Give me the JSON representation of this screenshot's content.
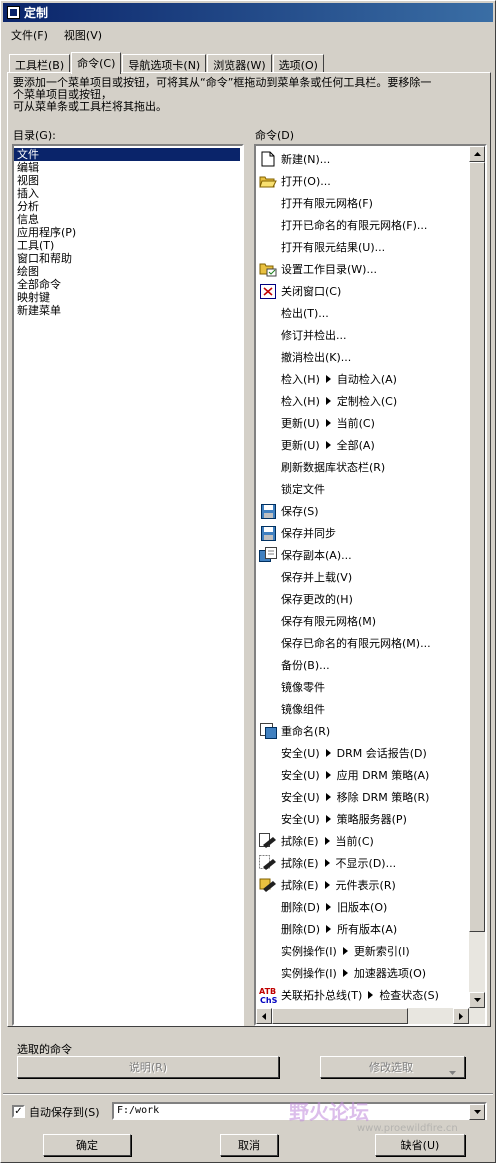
{
  "window": {
    "title": "定制"
  },
  "menubar": [
    {
      "label": "文件(F)"
    },
    {
      "label": "视图(V)"
    }
  ],
  "tabs": [
    {
      "label": "工具栏(B)",
      "active": false
    },
    {
      "label": "命令(C)",
      "active": true
    },
    {
      "label": "导航选项卡(N)",
      "active": false
    },
    {
      "label": "浏览器(W)",
      "active": false
    },
    {
      "label": "选项(O)",
      "active": false
    }
  ],
  "description": "要添加一个菜单项目或按钮，可将其从“命令”框拖动到菜单条或任何工具栏。要移除一\n个菜单项目或按钮，\n可从菜单条或工具栏将其拖出。",
  "categories": {
    "label": "目录(G):",
    "items": [
      "文件",
      "编辑",
      "视图",
      "插入",
      "分析",
      "信息",
      "应用程序(P)",
      "工具(T)",
      "窗口和帮助",
      "绘图",
      "全部命令",
      "映射键",
      "新建菜单"
    ],
    "selected_index": 0
  },
  "commands": {
    "label": "命令(D)",
    "items": [
      {
        "icon": "new-document-icon",
        "text": "新建(N)..."
      },
      {
        "icon": "open-folder-icon",
        "text": "打开(O)..."
      },
      {
        "icon": "",
        "text": "打开有限元网格(F)"
      },
      {
        "icon": "",
        "text": "打开已命名的有限元网格(F)..."
      },
      {
        "icon": "",
        "text": "打开有限元结果(U)..."
      },
      {
        "icon": "working-directory-icon",
        "text": "设置工作目录(W)..."
      },
      {
        "icon": "close-window-icon",
        "text": "关闭窗口(C)"
      },
      {
        "icon": "",
        "text": "检出(T)..."
      },
      {
        "icon": "",
        "text": "修订并检出..."
      },
      {
        "icon": "",
        "text": "撤消检出(K)..."
      },
      {
        "icon": "",
        "text": "检入(H)",
        "sub": "自动检入(A)"
      },
      {
        "icon": "",
        "text": "检入(H)",
        "sub": "定制检入(C)"
      },
      {
        "icon": "",
        "text": "更新(U)",
        "sub": "当前(C)"
      },
      {
        "icon": "",
        "text": "更新(U)",
        "sub": "全部(A)"
      },
      {
        "icon": "",
        "text": "刷新数据库状态栏(R)"
      },
      {
        "icon": "",
        "text": "锁定文件"
      },
      {
        "icon": "save-icon",
        "text": "保存(S)"
      },
      {
        "icon": "save-sync-icon",
        "text": "保存并同步"
      },
      {
        "icon": "save-copy-icon",
        "text": "保存副本(A)..."
      },
      {
        "icon": "",
        "text": "保存并上载(V)"
      },
      {
        "icon": "",
        "text": "保存更改的(H)"
      },
      {
        "icon": "",
        "text": "保存有限元网格(M)"
      },
      {
        "icon": "",
        "text": "保存已命名的有限元网格(M)..."
      },
      {
        "icon": "",
        "text": "备份(B)..."
      },
      {
        "icon": "",
        "text": "镜像零件"
      },
      {
        "icon": "",
        "text": "镜像组件"
      },
      {
        "icon": "rename-icon",
        "text": "重命名(R)"
      },
      {
        "icon": "",
        "text": "安全(U)",
        "sub": "DRM 会话报告(D)"
      },
      {
        "icon": "",
        "text": "安全(U)",
        "sub": "应用 DRM 策略(A)"
      },
      {
        "icon": "",
        "text": "安全(U)",
        "sub": "移除 DRM 策略(R)"
      },
      {
        "icon": "",
        "text": "安全(U)",
        "sub": "策略服务器(P)"
      },
      {
        "icon": "erase-current-icon",
        "text": "拭除(E)",
        "sub": "当前(C)"
      },
      {
        "icon": "erase-undisplayed-icon",
        "text": "拭除(E)",
        "sub": "不显示(D)..."
      },
      {
        "icon": "erase-representation-icon",
        "text": "拭除(E)",
        "sub": "元件表示(R)"
      },
      {
        "icon": "",
        "text": "删除(D)",
        "sub": "旧版本(O)"
      },
      {
        "icon": "",
        "text": "删除(D)",
        "sub": "所有版本(A)"
      },
      {
        "icon": "",
        "text": "实例操作(I)",
        "sub": "更新索引(I)"
      },
      {
        "icon": "",
        "text": "实例操作(I)",
        "sub": "加速器选项(O)"
      },
      {
        "icon": "atb-icon",
        "text": "关联拓扑总线(T)",
        "sub": "检查状态(S)"
      }
    ]
  },
  "selected_command": {
    "label": "选取的命令",
    "describe_button": "说明(R)",
    "modify_button": "修改选取"
  },
  "autosave": {
    "label": "自动保存到(S)",
    "checked": true,
    "value": "F:/work"
  },
  "buttons": {
    "ok": "确定",
    "cancel": "取消",
    "default": "缺省(U)"
  },
  "watermark": {
    "text": "野火论坛",
    "sub": "www.proewildfire.cn"
  }
}
